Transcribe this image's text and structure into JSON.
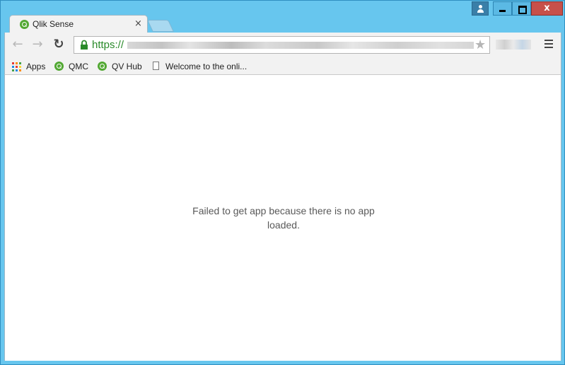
{
  "window": {
    "controls": {
      "close_label": "x"
    },
    "colors": {
      "frame": "#67c6ee",
      "close_button": "#c7504a"
    }
  },
  "tabs": [
    {
      "label": "Qlik Sense",
      "icon": "qlik-icon",
      "close_label": "×",
      "active": true
    }
  ],
  "toolbar": {
    "back_icon": "←",
    "forward_icon": "→",
    "reload_icon": "↻",
    "address": {
      "scheme": "https://",
      "lock_icon": "lock-icon"
    },
    "star_icon": "★",
    "menu_icon": "hamburger-icon"
  },
  "bookmarks": [
    {
      "label": "Apps",
      "icon": "apps-grid-icon"
    },
    {
      "label": "QMC",
      "icon": "qlik-icon"
    },
    {
      "label": "QV Hub",
      "icon": "qlik-icon"
    },
    {
      "label": "Welcome to the onli...",
      "icon": "page-icon"
    }
  ],
  "content": {
    "message": "Failed to get app because there is no app loaded."
  }
}
